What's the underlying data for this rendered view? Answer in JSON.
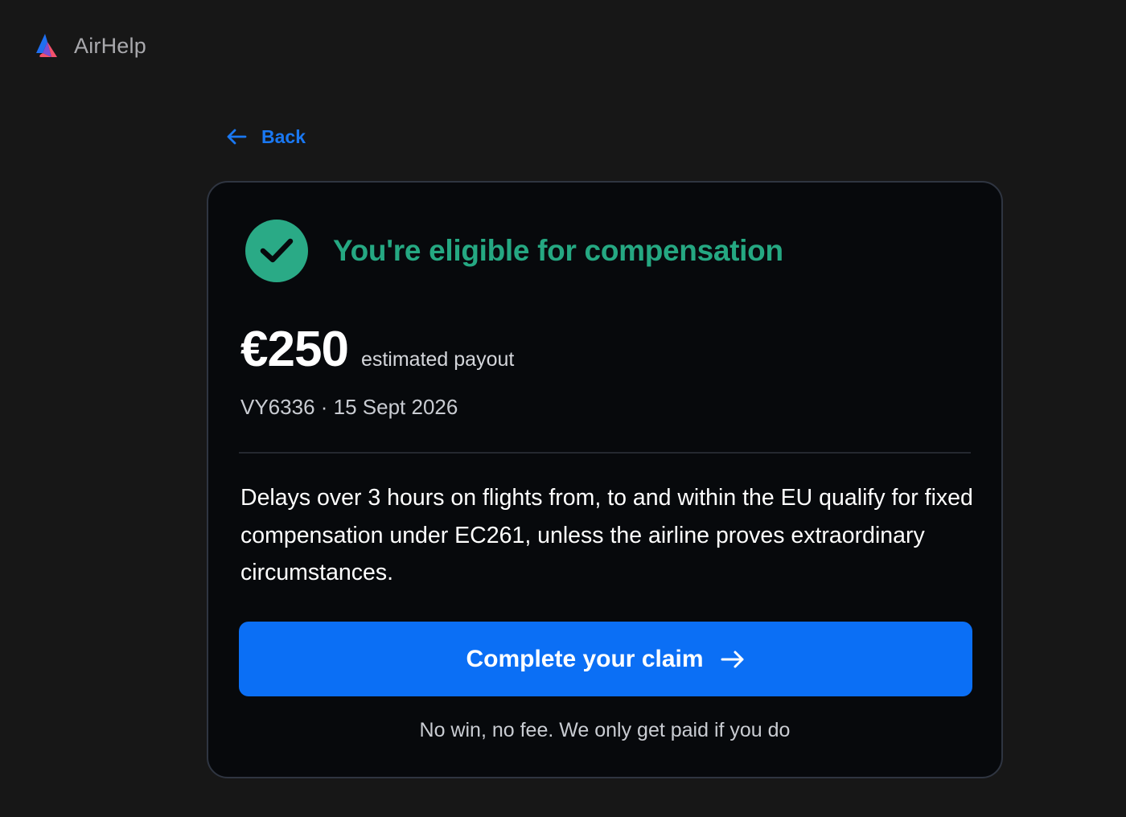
{
  "header": {
    "logo_icon": "airhelp-logo-icon",
    "brand": "AirHelp"
  },
  "nav": {
    "back_icon": "arrow-left-icon",
    "back_label": "Back"
  },
  "result": {
    "status_icon": "check-circle-icon",
    "title": "You're eligible for compensation",
    "amount": "€250",
    "amount_label": "estimated payout",
    "flight_meta": "VY6336 · 15 Sept 2026",
    "description": "Delays over 3 hours on flights from, to and within the EU qualify for fixed compensation under EC261, unless the airline proves extraordinary circumstances.",
    "cta_label": "Complete your claim",
    "cta_icon": "arrow-right-icon",
    "footnote": "No win, no fee. We only get paid if you do"
  },
  "colors": {
    "background": "#171717",
    "card": "#07090c",
    "accent_blue": "#0b6ff5",
    "success_green": "#2aaa86",
    "logo_blue": "#1f6ff0",
    "logo_red": "#f4516c"
  }
}
